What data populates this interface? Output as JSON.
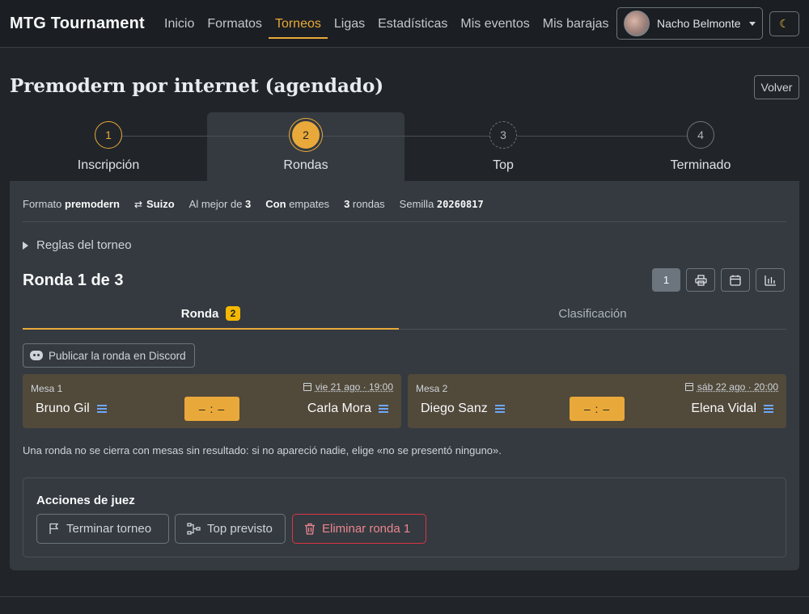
{
  "navbar": {
    "brand": "MTG Tournament",
    "links": [
      "Inicio",
      "Formatos",
      "Torneos",
      "Ligas",
      "Estadísticas",
      "Mis eventos",
      "Mis barajas"
    ],
    "active_link": "Torneos",
    "user_name": "Nacho Belmonte",
    "theme_icon": "☾"
  },
  "page": {
    "title": "Premodern por internet (agendado)",
    "back_label": "Volver"
  },
  "stepper": [
    {
      "number": "1",
      "label": "Inscripción",
      "state": "done"
    },
    {
      "number": "2",
      "label": "Rondas",
      "state": "current"
    },
    {
      "number": "3",
      "label": "Top",
      "state": "pending"
    },
    {
      "number": "4",
      "label": "Terminado",
      "state": "pending"
    }
  ],
  "meta": {
    "format_label": "Formato",
    "format_value": "premodern",
    "system": "Suizo",
    "best_of_label": "Al mejor de",
    "best_of_value": "3",
    "draws_strong": "Con",
    "draws_rest": "empates",
    "rounds_value": "3",
    "rounds_label": "rondas",
    "seed_label": "Semilla",
    "seed_value": "20260817"
  },
  "rules_label": "Reglas del torneo",
  "round": {
    "title": "Ronda 1 de 3",
    "current_round_button": "1"
  },
  "tabs": {
    "round_label": "Ronda",
    "round_badge": "2",
    "standings_label": "Clasificación"
  },
  "discord_button": "Publicar la ronda en Discord",
  "matches": [
    {
      "table": "Mesa 1",
      "date": "vie 21 ago · 19:00",
      "player1": "Bruno Gil",
      "player2": "Carla Mora",
      "score": "– : –"
    },
    {
      "table": "Mesa 2",
      "date": "sáb 22 ago · 20:00",
      "player1": "Diego Sanz",
      "player2": "Elena Vidal",
      "score": "– : –"
    }
  ],
  "notice": "Una ronda no se cierra con mesas sin resultado: si no apareció nadie, elige «no se presentó ninguno».",
  "judge": {
    "title": "Acciones de juez",
    "finish_label": "Terminar torneo",
    "top_label": "Top previsto",
    "delete_label": "Eliminar ronda 1"
  },
  "colors": {
    "accent": "#e9a93a",
    "badge": "#f5b800",
    "danger": "#dc3545",
    "panel": "#343a40",
    "match_bg": "#51493a"
  }
}
